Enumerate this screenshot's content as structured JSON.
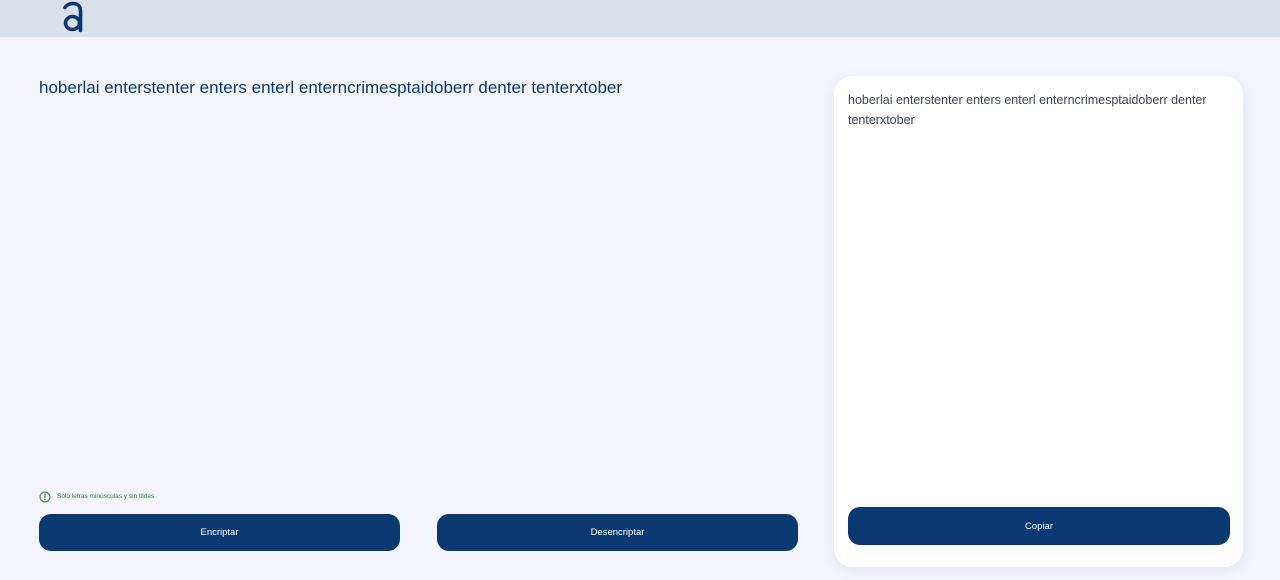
{
  "header": {
    "logo_icon": "alura-a-logo-icon"
  },
  "input": {
    "text": "hoberlai enterstenter enters enterl enterncrimesptaidoberr denter tenterxtober"
  },
  "hint": {
    "icon": "info-circle-icon",
    "text": "Solo letras minúsculas y sin tildes"
  },
  "actions": {
    "encrypt_label": "Encriptar",
    "decrypt_label": "Desencriptar"
  },
  "output": {
    "text": "hoberlai enterstenter enters enterl enterncrimesptaidoberr denter tenterxtober",
    "copy_label": "Copiar"
  },
  "colors": {
    "background": "#f2f5fc",
    "header": "#d9e0ea",
    "primary": "#0a3871",
    "hint": "#2f7d3a",
    "card": "#ffffff"
  }
}
